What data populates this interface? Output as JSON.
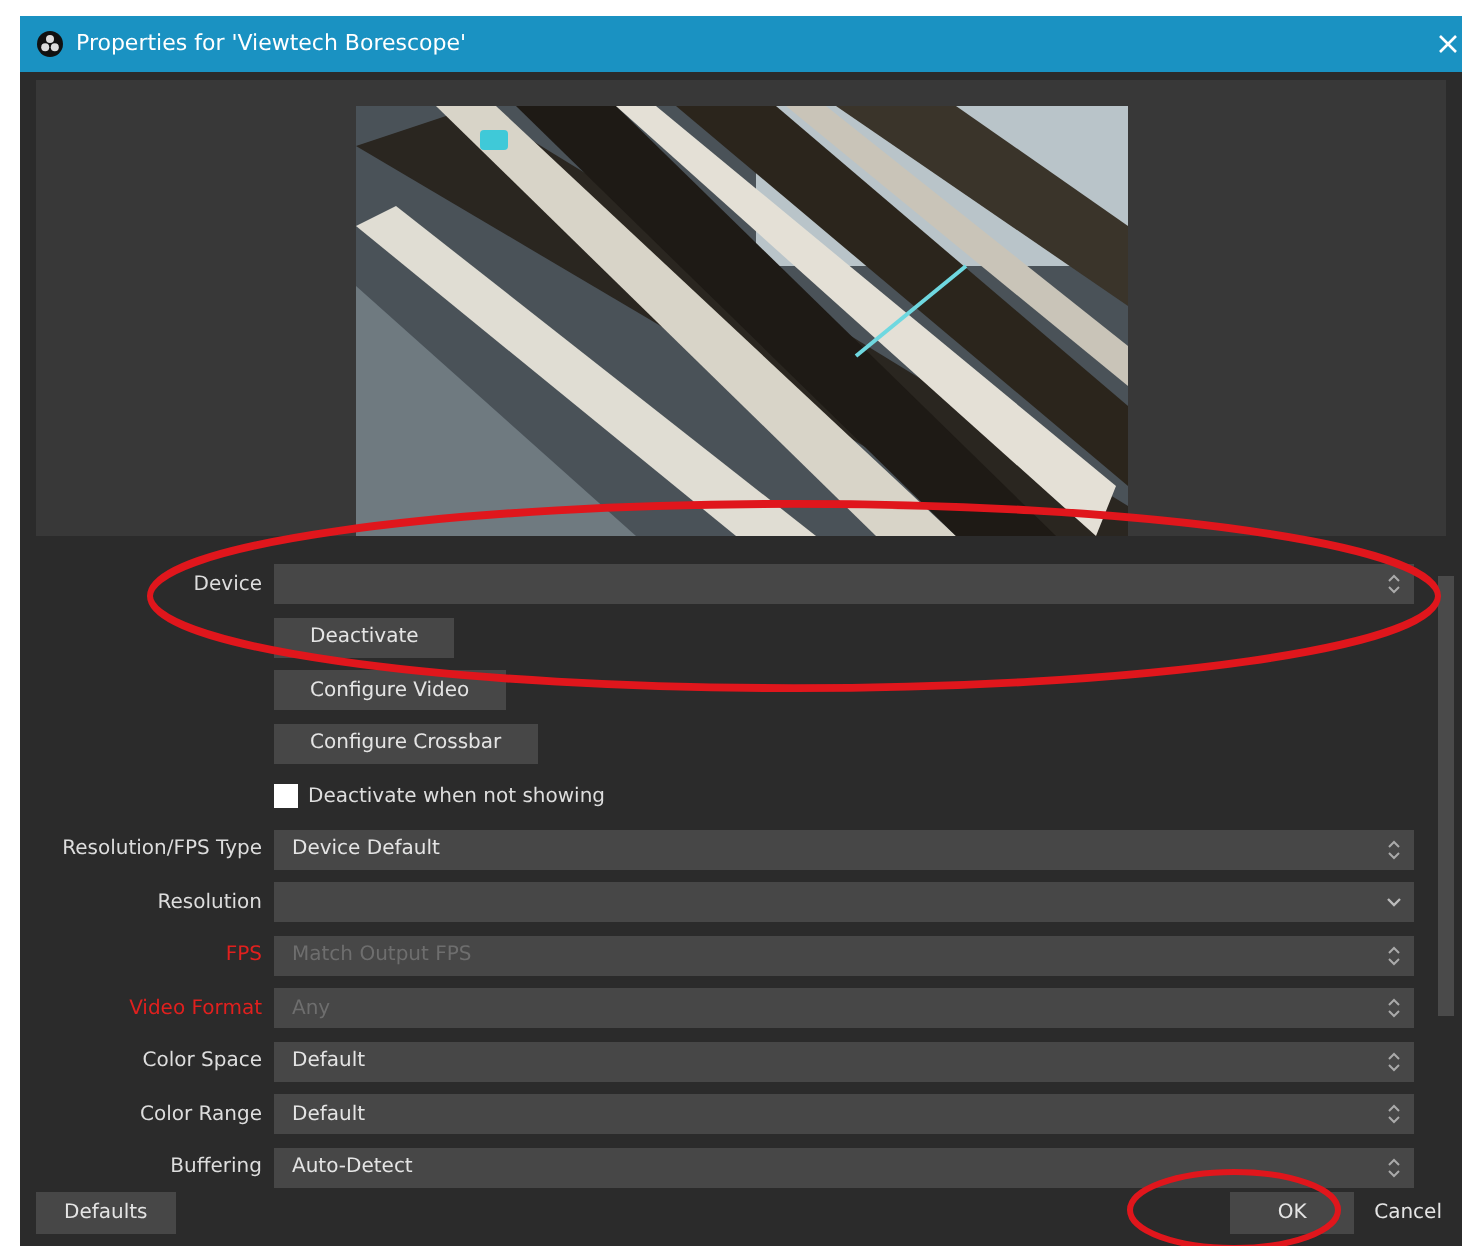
{
  "window": {
    "title": "Properties for 'Viewtech Borescope'"
  },
  "rows": [
    {
      "kind": "spin",
      "label": "Device",
      "value": "",
      "error": false
    },
    {
      "kind": "button",
      "label": "Deactivate"
    },
    {
      "kind": "button",
      "label": "Configure Video"
    },
    {
      "kind": "button",
      "label": "Configure Crossbar"
    },
    {
      "kind": "checkbox",
      "label": "Deactivate when not showing",
      "checked": false
    },
    {
      "kind": "spin",
      "label": "Resolution/FPS Type",
      "value": "Device Default",
      "error": false,
      "disabled": false
    },
    {
      "kind": "dropdown",
      "label": "Resolution",
      "value": "",
      "error": false
    },
    {
      "kind": "spin",
      "label": "FPS",
      "value": "Match Output FPS",
      "error": true,
      "disabled": true
    },
    {
      "kind": "spin",
      "label": "Video Format",
      "value": "Any",
      "error": true,
      "disabled": true
    },
    {
      "kind": "spin",
      "label": "Color Space",
      "value": "Default",
      "error": false,
      "disabled": false
    },
    {
      "kind": "spin",
      "label": "Color Range",
      "value": "Default",
      "error": false,
      "disabled": false
    },
    {
      "kind": "spin",
      "label": "Buffering",
      "value": "Auto-Detect",
      "error": false,
      "disabled": false
    }
  ],
  "footer": {
    "left": "Defaults",
    "buttons": [
      "OK",
      "Cancel"
    ]
  },
  "highlights": {
    "device_row": true,
    "ok_button": true
  }
}
